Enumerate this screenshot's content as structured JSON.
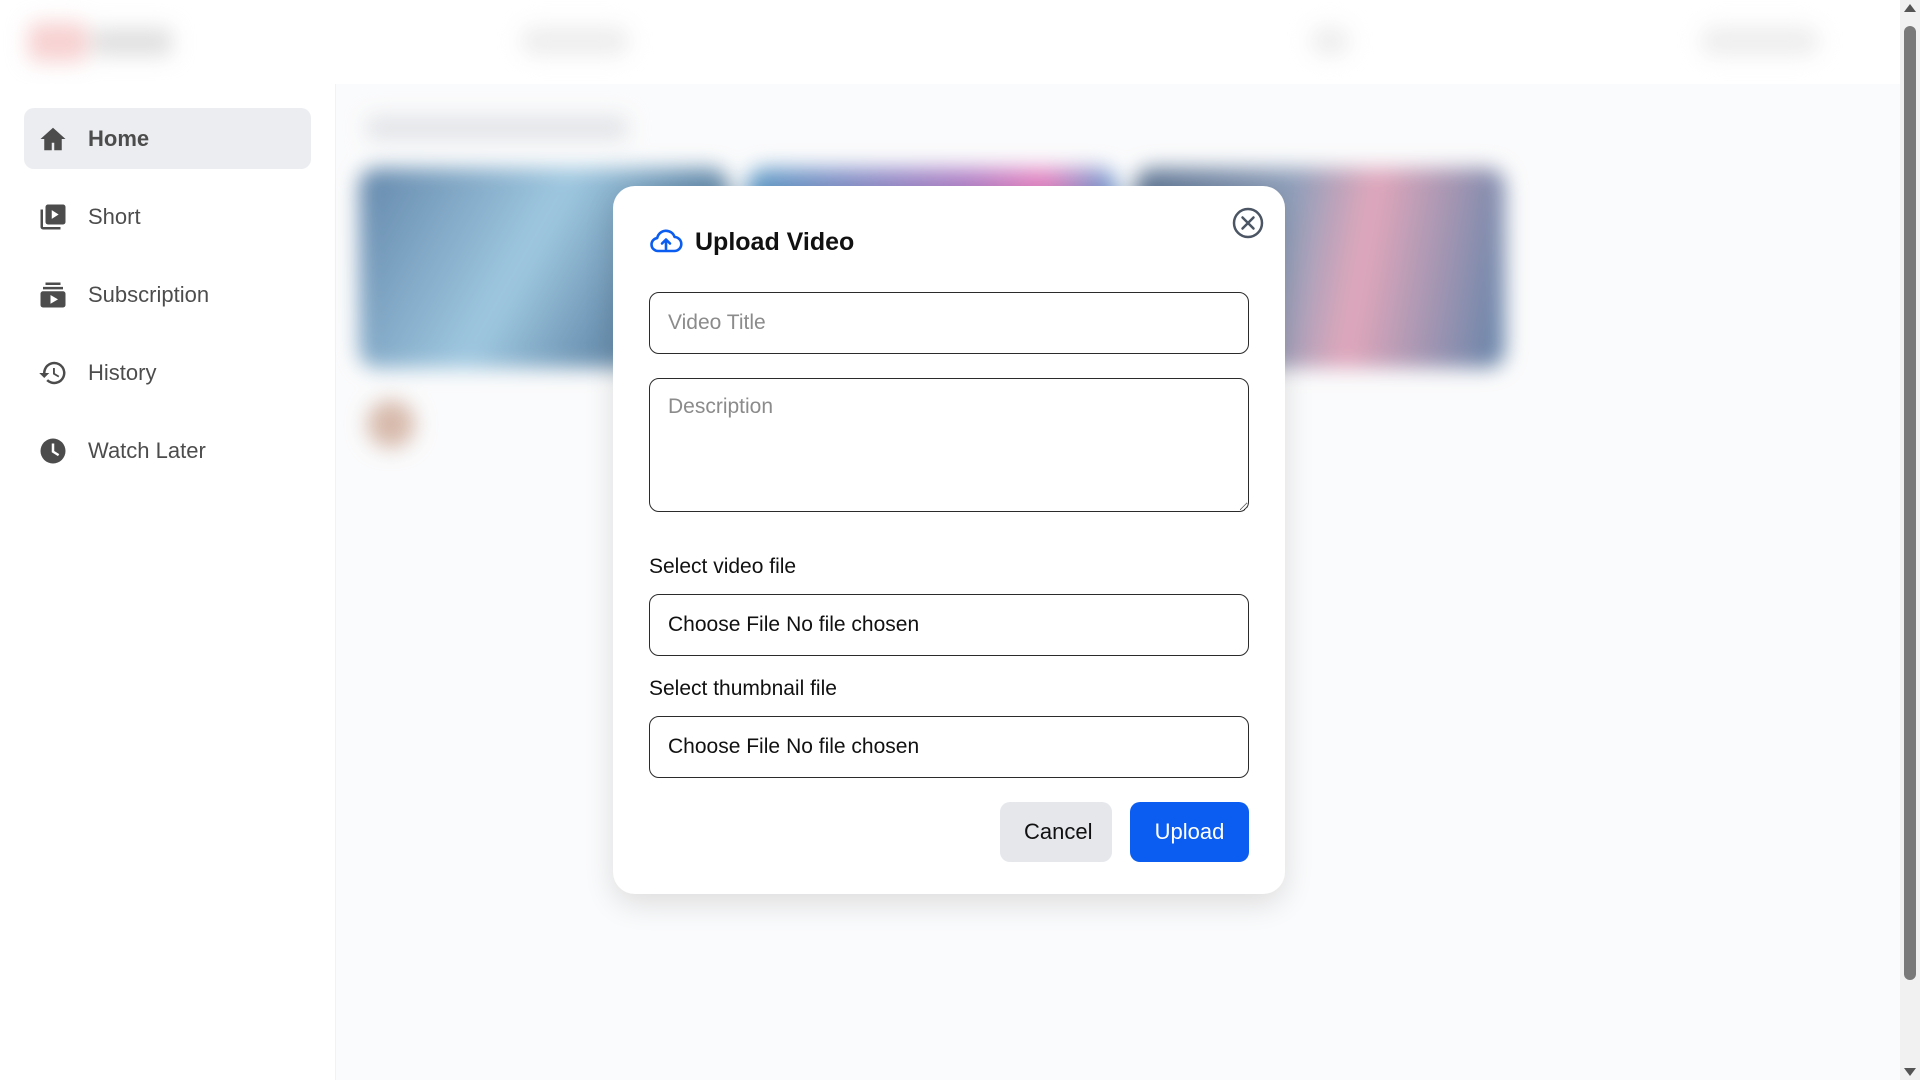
{
  "sidebar": {
    "items": [
      {
        "label": "Home",
        "icon": "home-icon",
        "active": true
      },
      {
        "label": "Short",
        "icon": "short-icon",
        "active": false
      },
      {
        "label": "Subscription",
        "icon": "subscription-icon",
        "active": false
      },
      {
        "label": "History",
        "icon": "history-icon",
        "active": false
      },
      {
        "label": "Watch Later",
        "icon": "clock-icon",
        "active": false
      }
    ]
  },
  "modal": {
    "title": "Upload Video",
    "title_icon": "cloud-upload-icon",
    "close_icon": "close-circle-icon",
    "title_field": {
      "placeholder": "Video Title",
      "value": ""
    },
    "description_field": {
      "placeholder": "Description",
      "value": ""
    },
    "video_file": {
      "label": "Select video file",
      "button": "Choose File",
      "status": "No file chosen"
    },
    "thumbnail_file": {
      "label": "Select thumbnail file",
      "button": "Choose File",
      "status": "No file chosen"
    },
    "cancel_label": "Cancel",
    "upload_label": "Upload"
  },
  "colors": {
    "accent": "#0b5cf0",
    "nav_active_bg": "#e5e7eb",
    "cancel_bg": "#e5e7eb"
  }
}
